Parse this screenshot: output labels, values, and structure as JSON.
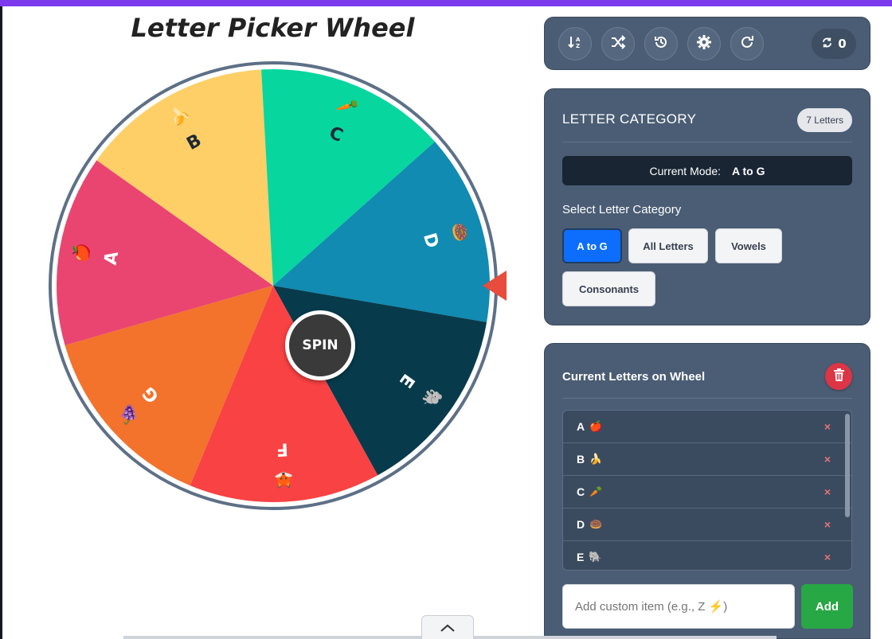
{
  "title": "Letter Picker Wheel",
  "wheel": {
    "spin_label": "SPIN",
    "segments": [
      {
        "letter": "A",
        "emoji": "🍎",
        "color": "#ea4571"
      },
      {
        "letter": "B",
        "emoji": "🍌",
        "color": "#fdcf66"
      },
      {
        "letter": "C",
        "emoji": "🥕",
        "color": "#07d69e"
      },
      {
        "letter": "D",
        "emoji": "🍩",
        "color": "#118bb2"
      },
      {
        "letter": "E",
        "emoji": "🐘",
        "color": "#073b4c"
      },
      {
        "letter": "F",
        "emoji": "🦊",
        "color": "#f94243"
      },
      {
        "letter": "G",
        "emoji": "🍇",
        "color": "#f3722c"
      }
    ],
    "pointer_color": "#e74c3c"
  },
  "toolbar": {
    "buttons": [
      "sort-icon",
      "shuffle-icon",
      "history-icon",
      "settings-icon",
      "redo-icon"
    ],
    "counter_icon": "sync-icon",
    "counter_value": "0"
  },
  "category": {
    "heading": "LETTER CATEGORY",
    "badge": "7 Letters",
    "mode_label": "Current Mode:",
    "mode_value": "A to G",
    "select_label": "Select Letter Category",
    "options": [
      "A to G",
      "All Letters",
      "Vowels",
      "Consonants"
    ],
    "active": "A to G"
  },
  "letters": {
    "heading": "Current Letters on Wheel",
    "items": [
      {
        "letter": "A",
        "emoji": "🍎"
      },
      {
        "letter": "B",
        "emoji": "🍌"
      },
      {
        "letter": "C",
        "emoji": "🥕"
      },
      {
        "letter": "D",
        "emoji": "🍩"
      },
      {
        "letter": "E",
        "emoji": "🐘"
      }
    ],
    "remove_symbol": "×",
    "input_placeholder": "Add custom item (e.g., Z ⚡)",
    "add_label": "Add"
  },
  "colors": {
    "accent_bar": "#7c3aed",
    "panel": "#4a5d74",
    "active_button": "#0d6efd",
    "add_button": "#28a745",
    "delete_button": "#dc3545"
  }
}
